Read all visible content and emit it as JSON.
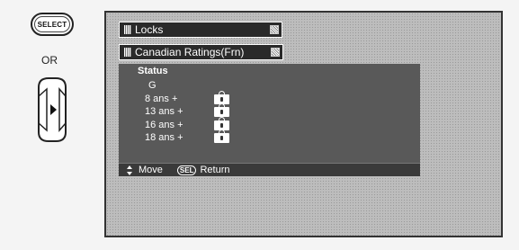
{
  "remote": {
    "select_label": "SELECT",
    "or_label": "OR",
    "arrow_icon": "right-arrow-icon"
  },
  "menu": {
    "title": "Locks",
    "submenu": "Canadian Ratings(Frn)",
    "status_label": "Status",
    "ratings": [
      {
        "label": "G",
        "locked": false
      },
      {
        "label": "8 ans +",
        "locked": true
      },
      {
        "label": "13 ans +",
        "locked": true
      },
      {
        "label": "16 ans +",
        "locked": true
      },
      {
        "label": "18 ans +",
        "locked": true
      }
    ]
  },
  "footer": {
    "move_label": "Move",
    "sel_badge": "SEL",
    "return_label": "Return"
  }
}
